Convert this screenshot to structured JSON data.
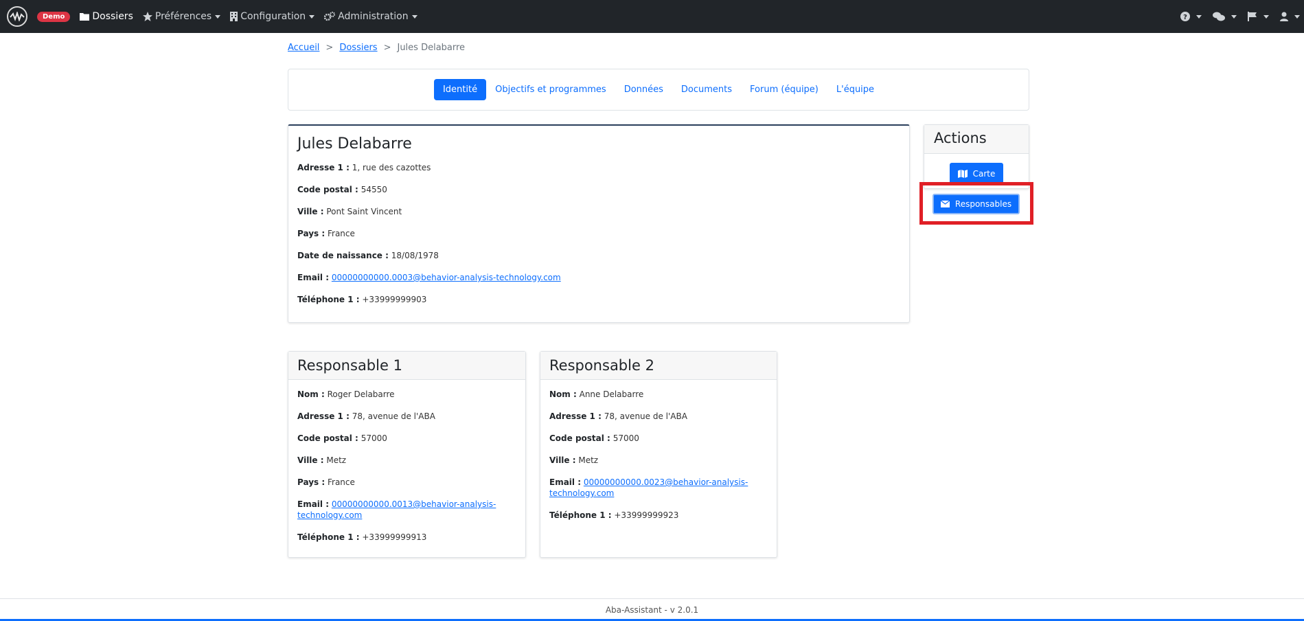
{
  "navbar": {
    "badge": "Demo",
    "items": [
      {
        "label": "Dossiers",
        "icon": "folder-icon"
      },
      {
        "label": "Préférences",
        "icon": "star-icon"
      },
      {
        "label": "Configuration",
        "icon": "building-icon"
      },
      {
        "label": "Administration",
        "icon": "gears-icon"
      }
    ],
    "right_icons": [
      "help-icon",
      "chat-icon",
      "flag-icon",
      "user-icon"
    ]
  },
  "breadcrumb": {
    "home": "Accueil",
    "dossiers": "Dossiers",
    "current": "Jules Delabarre",
    "separator": ">"
  },
  "tabs": [
    {
      "label": "Identité",
      "active": true
    },
    {
      "label": "Objectifs et programmes",
      "active": false
    },
    {
      "label": "Données",
      "active": false
    },
    {
      "label": "Documents",
      "active": false
    },
    {
      "label": "Forum (équipe)",
      "active": false
    },
    {
      "label": "L'équipe",
      "active": false
    }
  ],
  "patient": {
    "name": "Jules Delabarre",
    "fields": [
      {
        "label": "Adresse 1 :",
        "value": "1, rue des cazottes"
      },
      {
        "label": "Code postal :",
        "value": "54550"
      },
      {
        "label": "Ville :",
        "value": "Pont Saint Vincent"
      },
      {
        "label": "Pays :",
        "value": "France"
      },
      {
        "label": "Date de naissance :",
        "value": "18/08/1978"
      },
      {
        "label": "Email :",
        "value": "00000000000.0003@behavior-analysis-technology.com"
      },
      {
        "label": "Téléphone 1 :",
        "value": "+33999999903"
      }
    ]
  },
  "responsable1": {
    "title": "Responsable 1",
    "fields": [
      {
        "label": "Nom :",
        "value": "Roger Delabarre"
      },
      {
        "label": "Adresse 1 :",
        "value": "78, avenue de l'ABA"
      },
      {
        "label": "Code postal :",
        "value": "57000"
      },
      {
        "label": "Ville :",
        "value": "Metz"
      },
      {
        "label": "Pays :",
        "value": "France"
      },
      {
        "label": "Email :",
        "value": "00000000000.0013@behavior-analysis-technology.com"
      },
      {
        "label": "Téléphone 1 :",
        "value": "+33999999913"
      }
    ]
  },
  "responsable2": {
    "title": "Responsable 2",
    "fields": [
      {
        "label": "Nom :",
        "value": "Anne Delabarre"
      },
      {
        "label": "Adresse 1 :",
        "value": "78, avenue de l'ABA"
      },
      {
        "label": "Code postal :",
        "value": "57000"
      },
      {
        "label": "Ville :",
        "value": "Metz"
      },
      {
        "label": "Email :",
        "value": "00000000000.0023@behavior-analysis-technology.com"
      },
      {
        "label": "Téléphone 1 :",
        "value": "+33999999923"
      }
    ]
  },
  "actions": {
    "title": "Actions",
    "carte": "Carte",
    "responsables": "Responsables"
  },
  "footer": "Aba-Assistant - v 2.0.1",
  "colors": {
    "primary": "#0d6efd",
    "navbar": "#212529",
    "badge": "#dc3545",
    "highlight": "#e01f26"
  }
}
